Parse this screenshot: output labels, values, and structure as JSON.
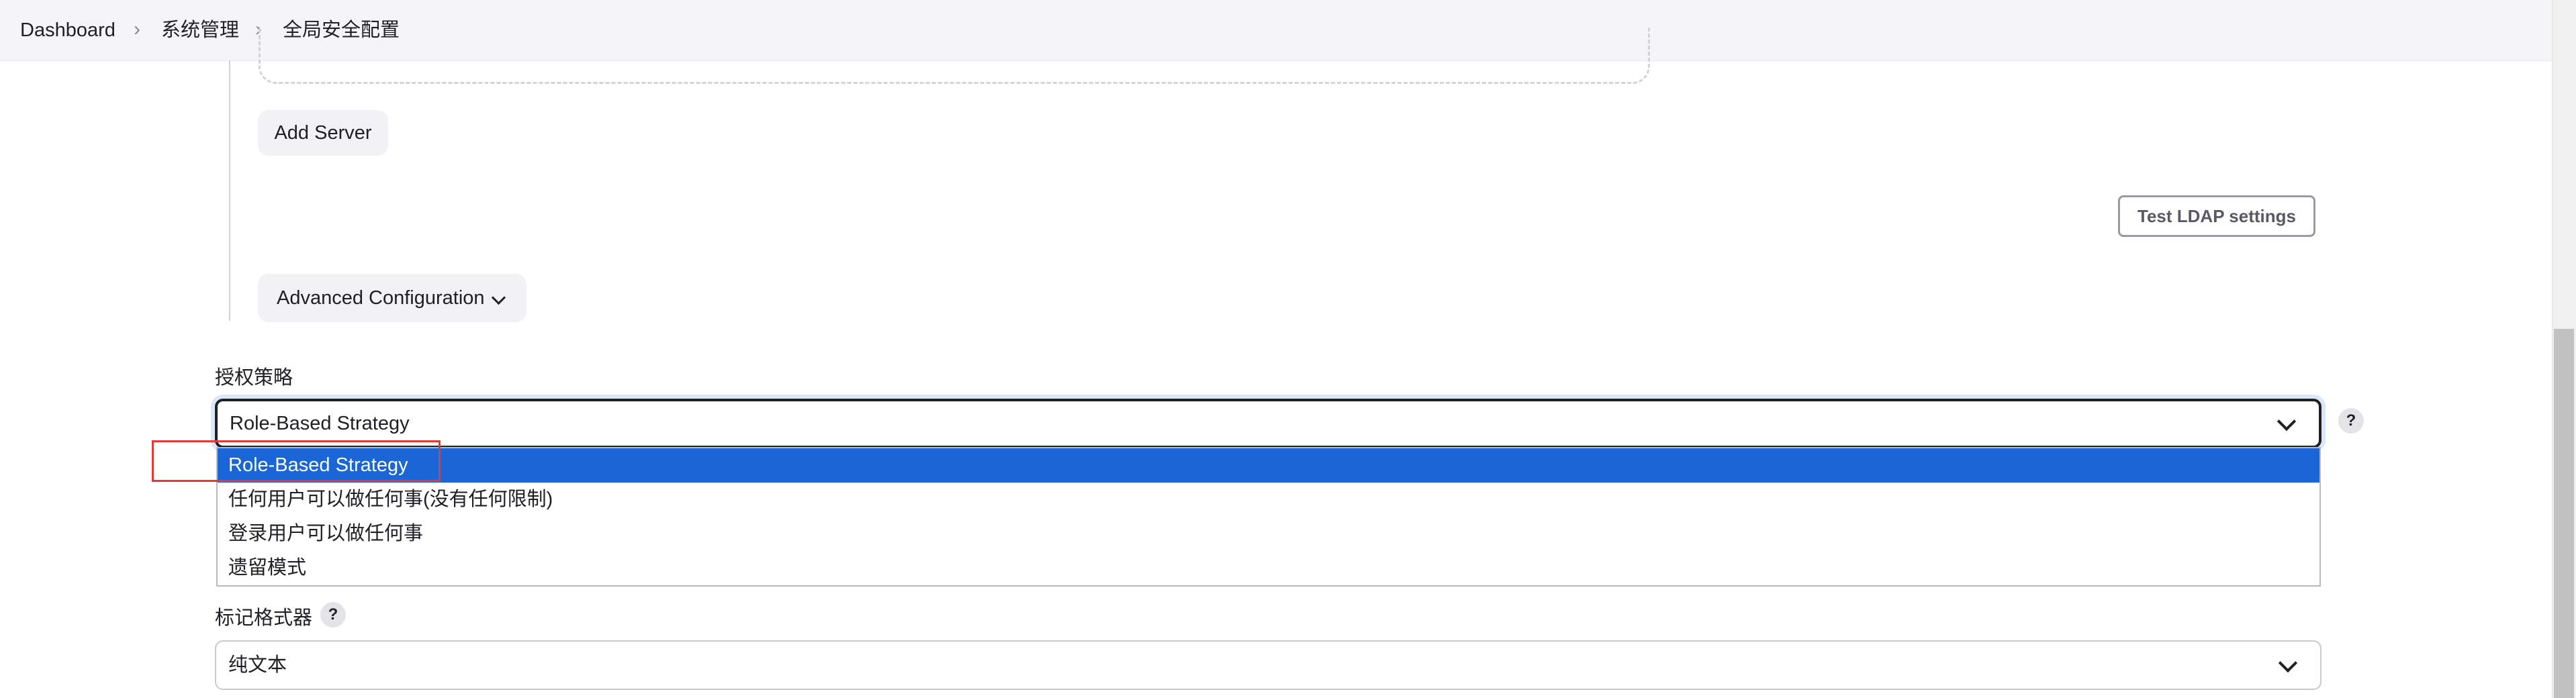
{
  "breadcrumb": {
    "items": [
      "Dashboard",
      "系统管理",
      "全局安全配置"
    ]
  },
  "ldap": {
    "add_server_label": "Add Server",
    "test_ldap_label": "Test LDAP settings",
    "advanced_config_label": "Advanced Configuration"
  },
  "authorization": {
    "label": "授权策略",
    "selected": "Role-Based Strategy",
    "options": [
      "Role-Based Strategy",
      "任何用户可以做任何事(没有任何限制)",
      "登录用户可以做任何事",
      "遗留模式"
    ],
    "help_symbol": "?"
  },
  "markup_formatter": {
    "label": "标记格式器",
    "selected": "纯文本",
    "help_symbol": "?"
  },
  "icons": [
    "chevron-right-icon",
    "chevron-down-icon",
    "help-icon"
  ],
  "colors": {
    "accent": "#1a66d6",
    "annotation": "#e53935",
    "header_bg": "#f5f5f7"
  }
}
